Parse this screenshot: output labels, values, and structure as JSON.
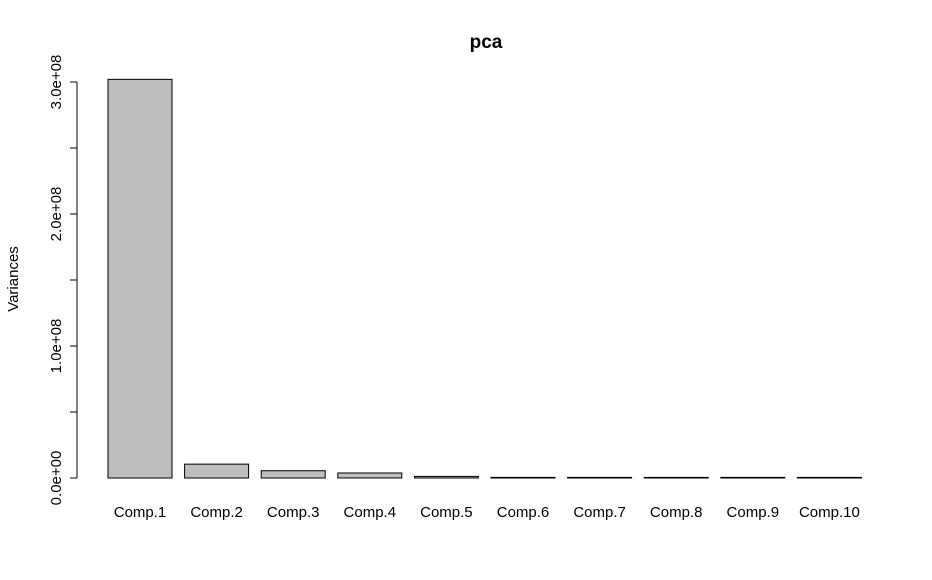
{
  "chart_data": {
    "type": "bar",
    "title": "pca",
    "xlabel": "",
    "ylabel": "Variances",
    "ylim": [
      0,
      300000000
    ],
    "y_ticks": [
      0,
      50000000,
      100000000,
      150000000,
      200000000,
      250000000,
      300000000
    ],
    "y_tick_labels": [
      "0.0e+00",
      "",
      "1.0e+08",
      "",
      "2.0e+08",
      "",
      "3.0e+08"
    ],
    "categories": [
      "Comp.1",
      "Comp.2",
      "Comp.3",
      "Comp.4",
      "Comp.5",
      "Comp.6",
      "Comp.7",
      "Comp.8",
      "Comp.9",
      "Comp.10"
    ],
    "values": [
      302000000,
      10500000,
      5500000,
      3800000,
      1200000,
      300000,
      200000,
      150000,
      100000,
      80000
    ],
    "bar_color": "#bebebe",
    "bar_stroke": "#000000",
    "grid": false
  }
}
